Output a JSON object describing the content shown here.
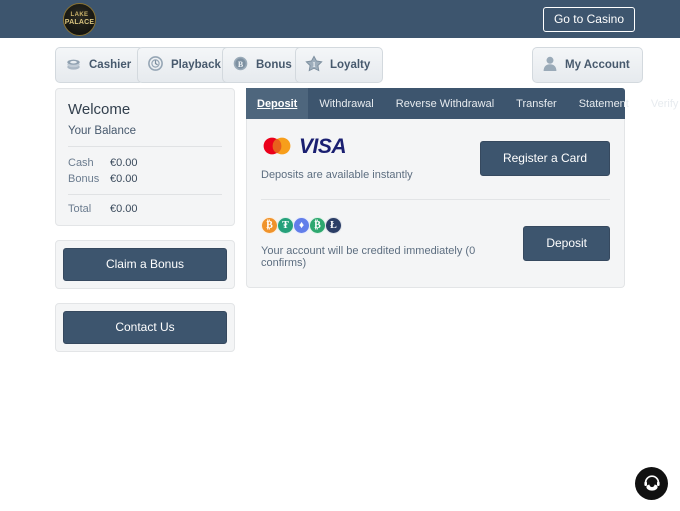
{
  "header": {
    "logo": {
      "name": "lake-palace-logo",
      "line1": "LAKE",
      "line2": "PALACE"
    },
    "goto_casino_label": "Go to Casino",
    "bg_color": "#3d556e"
  },
  "nav": {
    "items": [
      {
        "label": "Cashier",
        "icon": "coin-stack-icon"
      },
      {
        "label": "Playback",
        "icon": "playback-disc-icon"
      },
      {
        "label": "Bonus",
        "icon": "bonus-coin-icon"
      },
      {
        "label": "Loyalty",
        "icon": "loyalty-star-icon"
      }
    ],
    "account": {
      "label": "My Account",
      "icon": "user-avatar-icon"
    }
  },
  "sidebar": {
    "welcome_title": "Welcome",
    "balance_heading": "Your Balance",
    "balances": [
      {
        "label": "Cash",
        "value": "€0.00"
      },
      {
        "label": "Bonus",
        "value": "€0.00"
      }
    ],
    "total": {
      "label": "Total",
      "value": "€0.00"
    },
    "claim_bonus_label": "Claim a Bonus",
    "contact_us_label": "Contact Us"
  },
  "main": {
    "tabs": [
      {
        "label": "Deposit",
        "active": true
      },
      {
        "label": "Withdrawal",
        "active": false
      },
      {
        "label": "Reverse Withdrawal",
        "active": false
      },
      {
        "label": "Transfer",
        "active": false
      },
      {
        "label": "Statement",
        "active": false
      },
      {
        "label": "Verify ID",
        "active": false
      }
    ],
    "methods": [
      {
        "type": "cards",
        "brands": [
          {
            "name": "mastercard-logo",
            "label": "Mastercard"
          },
          {
            "name": "visa-logo",
            "label": "VISA"
          }
        ],
        "note": "Deposits are available instantly",
        "action_label": "Register a Card"
      },
      {
        "type": "crypto",
        "coins": [
          {
            "name": "bitcoin-icon",
            "symbol": "₿",
            "color": "#f0932b"
          },
          {
            "name": "tether-icon",
            "symbol": "₮",
            "color": "#26a17b"
          },
          {
            "name": "ethereum-icon",
            "symbol": "♦",
            "color": "#627eea"
          },
          {
            "name": "bitcoin-cash-icon",
            "symbol": "₿",
            "color": "#2ea86f"
          },
          {
            "name": "litecoin-icon",
            "symbol": "Ł",
            "color": "#2b3e66"
          }
        ],
        "note": "Your account will be credited immediately (0 confirms)",
        "action_label": "Deposit"
      }
    ]
  },
  "chat": {
    "icon": "headset-support-icon",
    "label": "Live support"
  }
}
